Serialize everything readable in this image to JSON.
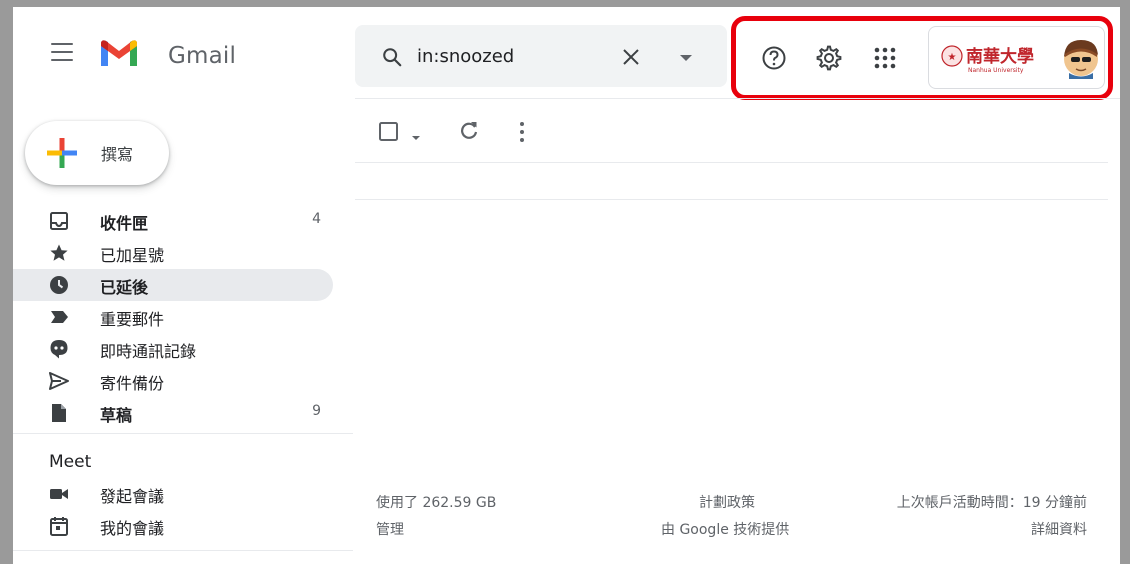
{
  "header": {
    "app_name": "Gmail",
    "search_value": "in:snoozed"
  },
  "sidebar": {
    "compose_label": "撰寫",
    "items": [
      {
        "label": "收件匣",
        "count": "4",
        "bold": true,
        "icon": "inbox-icon"
      },
      {
        "label": "已加星號",
        "count": "",
        "bold": false,
        "icon": "star-icon"
      },
      {
        "label": "已延後",
        "count": "",
        "bold": false,
        "icon": "clock-icon",
        "active": true
      },
      {
        "label": "重要郵件",
        "count": "",
        "bold": false,
        "icon": "important-icon"
      },
      {
        "label": "即時通訊記錄",
        "count": "",
        "bold": false,
        "icon": "chat-icon"
      },
      {
        "label": "寄件備份",
        "count": "",
        "bold": false,
        "icon": "send-icon"
      },
      {
        "label": "草稿",
        "count": "9",
        "bold": true,
        "icon": "draft-icon"
      }
    ],
    "meet": {
      "title": "Meet",
      "items": [
        {
          "label": "發起會議",
          "icon": "video-icon"
        },
        {
          "label": "我的會議",
          "icon": "calendar-icon"
        }
      ]
    }
  },
  "footer": {
    "storage": "使用了 262.59 GB",
    "manage": "管理",
    "policy": "計劃政策",
    "powered": "由 Google 技術提供",
    "last_activity": "上次帳戶活動時間：19 分鐘前",
    "details": "詳細資料"
  },
  "account": {
    "logo_text": "南華大學",
    "logo_subtext": "Nanhua University"
  },
  "colors": {
    "highlight": "#e8000c",
    "gmail_red": "#ea4335",
    "gmail_blue": "#4285f4",
    "gmail_green": "#34a853",
    "gmail_yellow": "#fbbc04",
    "icon_gray": "#5f6368"
  }
}
